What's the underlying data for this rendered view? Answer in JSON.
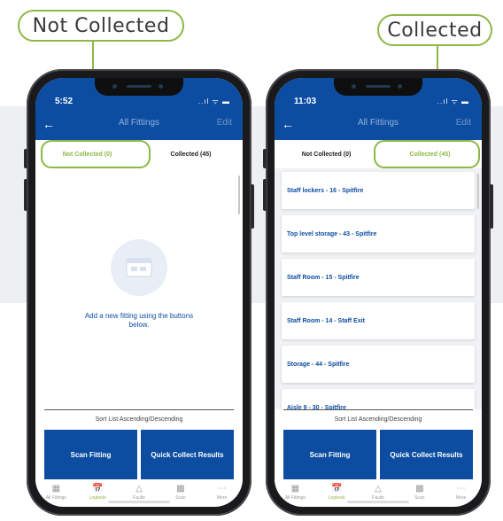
{
  "callouts": {
    "left": "Not Collected",
    "right": "Collected"
  },
  "colors": {
    "brand_blue": "#0c4da2",
    "accent_green": "#8cb845"
  },
  "phone_left": {
    "time": "5:52",
    "status_icons": "..ıl ᯤ ▬",
    "header_title": "All Fittings",
    "edit": "Edit",
    "tab_not_collected": "Not Collected (0)",
    "tab_collected": "Collected (45)",
    "active_tab": "not_collected",
    "empty_message": "Add a new fitting using the buttons below.",
    "sort_label": "Sort List Ascending/Descending",
    "scan_btn": "Scan Fitting",
    "quick_btn": "Quick Collect Results",
    "tabbar": [
      "All Fittings",
      "Logbook",
      "Faults",
      "Scan",
      "More"
    ],
    "active_bottom_tab": "Logbook"
  },
  "phone_right": {
    "time": "11:03",
    "status_icons": "..ıl ᯤ ▬",
    "header_title": "All Fittings",
    "edit": "Edit",
    "tab_not_collected": "Not Collected (0)",
    "tab_collected": "Collected (45)",
    "active_tab": "collected",
    "items": [
      "Staff lockers - 16 - Spitfire",
      "Top level storage - 43 - Spitfire",
      "Staff Room - 15 - Spitfire",
      "Staff Room - 14 - Staff Exit",
      "Storage - 44 - Spitfire",
      "Aisle 9 - 30 - Spitfire"
    ],
    "sort_label": "Sort List Ascending/Descending",
    "scan_btn": "Scan Fitting",
    "quick_btn": "Quick Collect Results",
    "tabbar": [
      "All Fittings",
      "Logbook",
      "Faults",
      "Scan",
      "More"
    ],
    "active_bottom_tab": "Logbook"
  }
}
